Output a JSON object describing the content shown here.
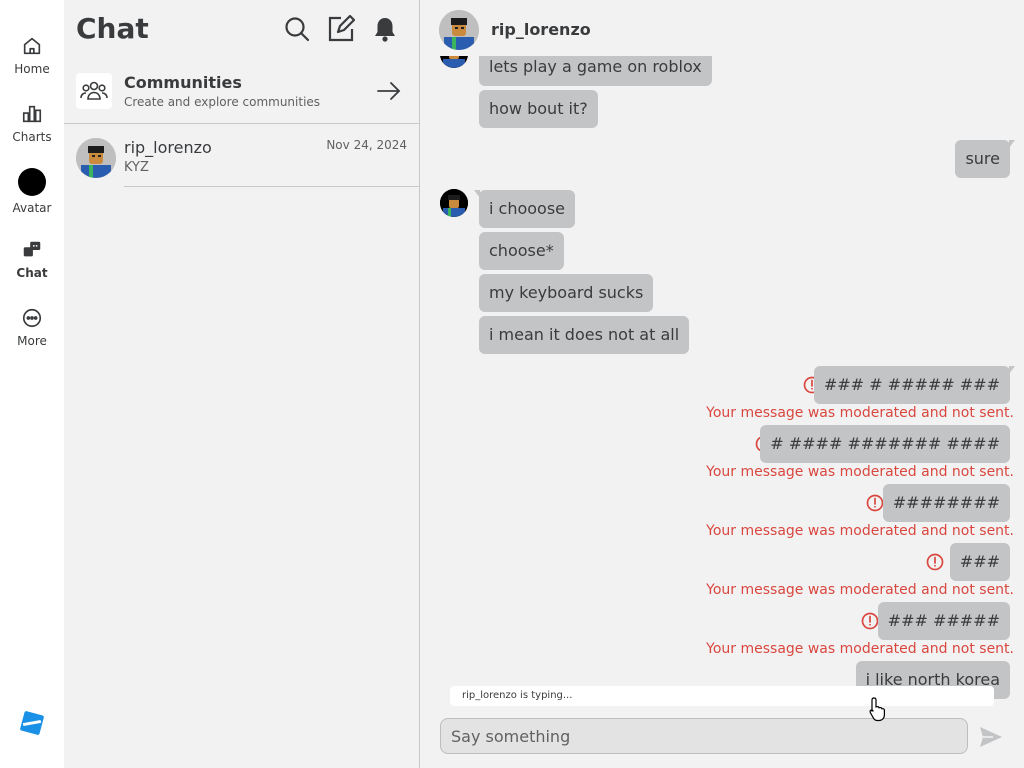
{
  "nav": {
    "items": [
      {
        "label": "Home",
        "icon": "home-icon"
      },
      {
        "label": "Charts",
        "icon": "charts-icon"
      },
      {
        "label": "Avatar",
        "icon": "avatar-icon"
      },
      {
        "label": "Chat",
        "icon": "chat-icon",
        "active": true
      },
      {
        "label": "More",
        "icon": "more-icon"
      }
    ],
    "logo": "roblox-logo-icon"
  },
  "chat_list": {
    "title": "Chat",
    "header_icons": [
      "search-icon",
      "compose-icon",
      "bell-icon"
    ],
    "communities": {
      "title": "Communities",
      "subtitle": "Create and explore communities"
    },
    "conversations": [
      {
        "name": "rip_lorenzo",
        "date": "Nov 24, 2024",
        "preview": "KYZ"
      }
    ]
  },
  "conversation": {
    "header_name": "rip_lorenzo",
    "messages": [
      {
        "from": "them",
        "text": "lets play a game on roblox"
      },
      {
        "from": "them",
        "text": "how bout it?"
      },
      {
        "from": "me",
        "text": "sure"
      },
      {
        "from": "them",
        "text": "i chooose"
      },
      {
        "from": "them",
        "text": "choose*"
      },
      {
        "from": "them",
        "text": "my keyboard sucks"
      },
      {
        "from": "them",
        "text": "i mean it does not at all"
      },
      {
        "from": "me",
        "text": "### # ##### ###",
        "moderated": true
      },
      {
        "from": "me",
        "text": "# #### ####### ####",
        "moderated": true
      },
      {
        "from": "me",
        "text": "########",
        "moderated": true
      },
      {
        "from": "me",
        "text": "###",
        "moderated": true
      },
      {
        "from": "me",
        "text": "### #####",
        "moderated": true
      },
      {
        "from": "me",
        "text": "i like north korea"
      }
    ],
    "moderation_note": "Your message was moderated and not sent.",
    "typing_indicator": "rip_lorenzo is typing...",
    "composer_placeholder": "Say something",
    "composer_value": ""
  },
  "colors": {
    "bubble": "#c3c4c6",
    "moderation": "#d9473f",
    "text": "#393b3d",
    "accent": "#1a91e6"
  }
}
